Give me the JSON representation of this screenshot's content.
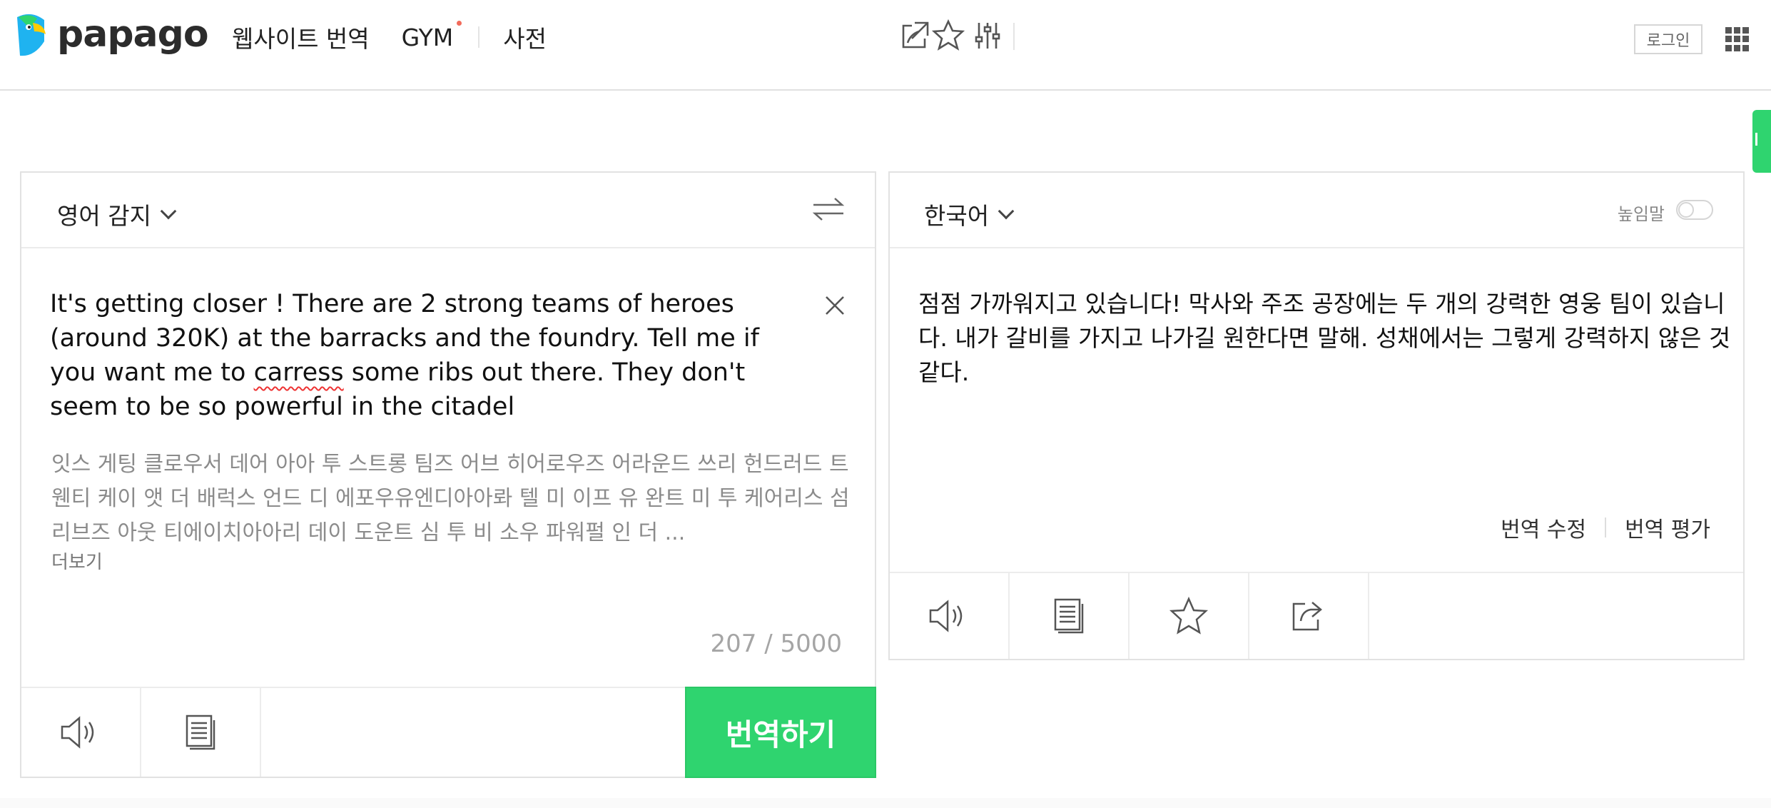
{
  "header": {
    "logo_text": "papago",
    "nav": [
      {
        "label": "웹사이트 번역"
      },
      {
        "label": "GYM"
      },
      {
        "label": "사전"
      }
    ],
    "login_label": "로그인",
    "icons": [
      "open-new-window-icon",
      "star-icon",
      "settings-sliders-icon",
      "apps-grid-icon"
    ]
  },
  "source": {
    "language": "영어 감지",
    "text_before": "It's getting closer ! There are 2 strong teams of heroes (around 320K) at the barracks and the foundry. Tell me if you want me to ",
    "text_misspelled": "carress",
    "text_after": " some ribs out there. They don't seem to be so powerful in the citadel",
    "pronunciation": "잇스 게팅 클로우서 데어 아아 투 스트롱 팀즈 어브 히어로우즈 어라운드 쓰리 헌드러드 트웬티 케이 앳 더 배럭스 언드 디 에포우유엔디아아롸 텔 미 이프 유 완트 미 투 케어리스 섬 리브즈 아웃 티에이치아아리 데이 도운트 심 투 비 소우 파워펄 인 더 ...",
    "more_label": "더보기",
    "counter": "207 / 5000",
    "translate_button": "번역하기"
  },
  "target": {
    "language": "한국어",
    "honorific_label": "높임말",
    "honorific_on": false,
    "text": "점점 가까워지고 있습니다! 막사와 주조 공장에는 두 개의 강력한 영웅 팀이 있습니다. 내가 갈비를 가지고 나가길 원한다면 말해. 성채에서는 그렇게 강력하지 않은 것 같다.",
    "edit_label": "번역 수정",
    "rate_label": "번역 평가"
  },
  "colors": {
    "accent": "#2fd46f",
    "nav_dot": "#f26b5b",
    "border": "#e2e2e2"
  }
}
